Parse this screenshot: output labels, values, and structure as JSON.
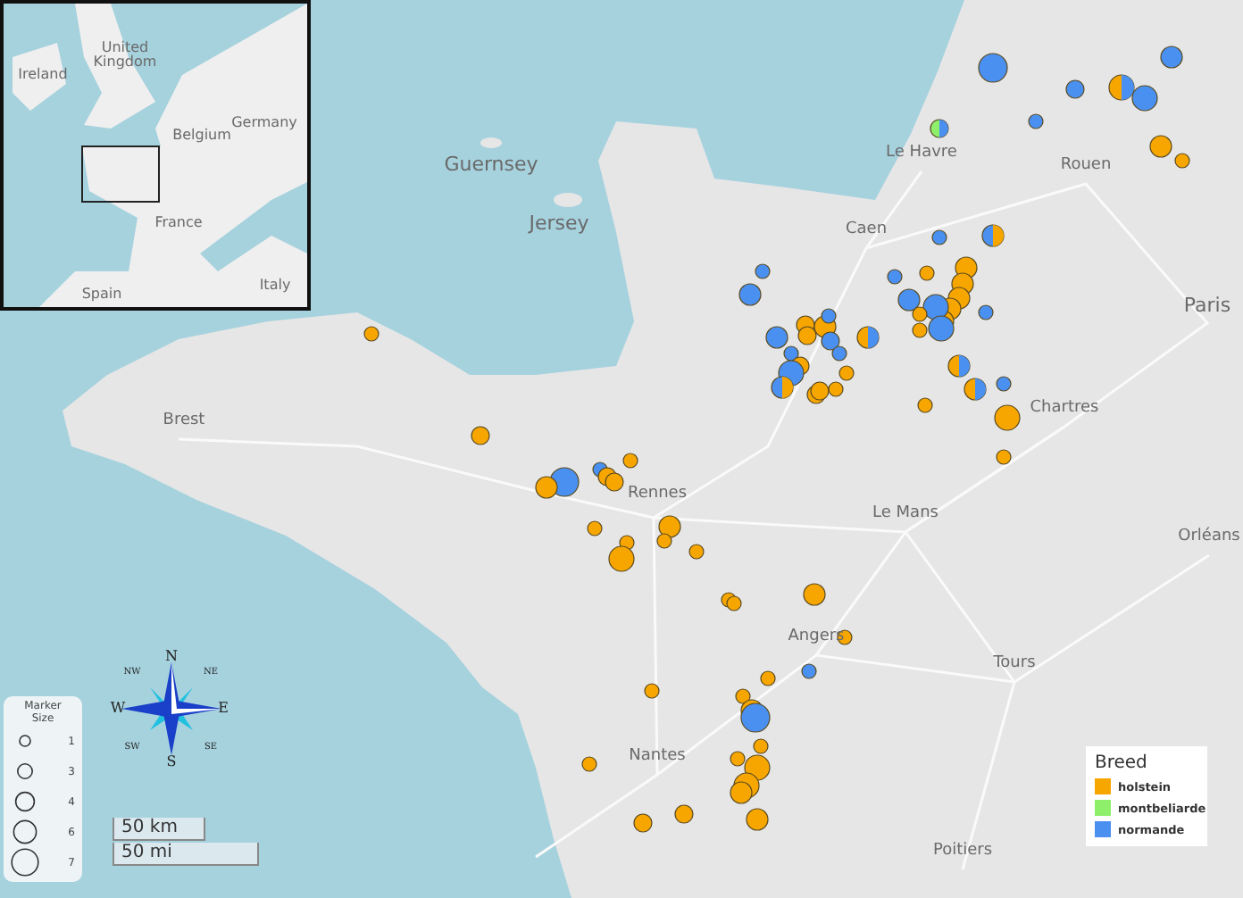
{
  "inset_map": {
    "labels": [
      "Ireland",
      "United Kingdom",
      "Belgium",
      "Germany",
      "France",
      "Spain",
      "Italy"
    ]
  },
  "place_labels": [
    "Guernsey",
    "Jersey",
    "Le Havre",
    "Rouen",
    "Caen",
    "Paris",
    "Brest",
    "Rennes",
    "Chartres",
    "Le Mans",
    "Orléans",
    "Angers",
    "Tours",
    "Nantes",
    "Poitiers"
  ],
  "marker_size_legend": {
    "title": "Marker Size",
    "items": [
      "1",
      "3",
      "4",
      "6",
      "7"
    ]
  },
  "compass": {
    "labels": [
      "N",
      "NE",
      "E",
      "SE",
      "S",
      "SW",
      "W",
      "NW"
    ]
  },
  "scale_bar": [
    "50 km",
    "50 mi"
  ],
  "legend": {
    "title": "Breed",
    "items": [
      {
        "label": "holstein",
        "color": "#f7a600"
      },
      {
        "label": "montbeliarde",
        "color": "#8ef06a"
      },
      {
        "label": "normande",
        "color": "#4a90f0"
      }
    ]
  }
}
